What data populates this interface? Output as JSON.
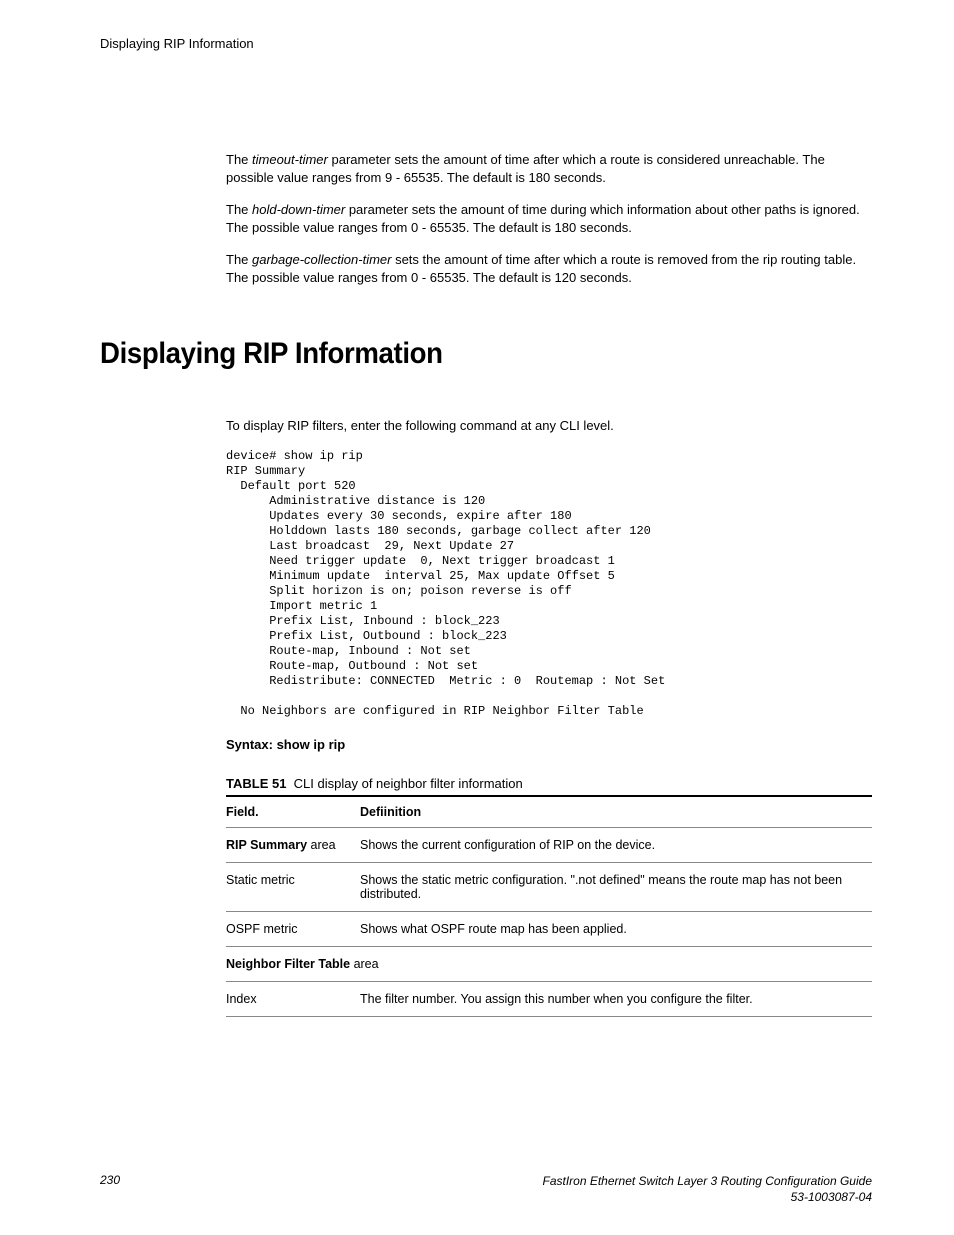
{
  "running_head": "Displaying RIP Information",
  "paragraphs": {
    "p1_pre": "The ",
    "p1_em": "timeout-timer",
    "p1_post": " parameter sets the amount of time after which a route is considered unreachable. The possible value ranges from 9 - 65535. The default is 180 seconds.",
    "p2_pre": "The ",
    "p2_em": "hold-down-timer",
    "p2_post": " parameter sets the amount of time during which information about other paths is ignored. The possible value ranges from 0 - 65535. The default is 180 seconds.",
    "p3_pre": "The ",
    "p3_em": "garbage-collection-timer",
    "p3_post": " sets the amount of time after which a route is removed from the rip routing table. The possible value ranges from 0 - 65535. The default is 120 seconds."
  },
  "section_title": "Displaying RIP Information",
  "intro": "To display RIP filters, enter the following command at any CLI level.",
  "cli_output": "device# show ip rip\nRIP Summary\n  Default port 520\n      Administrative distance is 120\n      Updates every 30 seconds, expire after 180\n      Holddown lasts 180 seconds, garbage collect after 120\n      Last broadcast  29, Next Update 27\n      Need trigger update  0, Next trigger broadcast 1\n      Minimum update  interval 25, Max update Offset 5\n      Split horizon is on; poison reverse is off\n      Import metric 1\n      Prefix List, Inbound : block_223\n      Prefix List, Outbound : block_223\n      Route-map, Inbound : Not set\n      Route-map, Outbound : Not set\n      Redistribute: CONNECTED  Metric : 0  Routemap : Not Set\n\n  No Neighbors are configured in RIP Neighbor Filter Table",
  "syntax_line": "Syntax: show ip rip",
  "table": {
    "number": "TABLE 51",
    "caption": "CLI display of neighbor filter information",
    "head_field": "Field.",
    "head_def": "Defiinition",
    "rows": [
      {
        "field_b": "RIP Summary",
        "field_rest": " area",
        "def": "Shows the current configuration of RIP on the device."
      },
      {
        "field": "Static metric",
        "def": "Shows the static metric configuration. \".not defined\" means the route map has not been distributed."
      },
      {
        "field": "OSPF metric",
        "def": "Shows what OSPF route map has been applied."
      },
      {
        "field_b": "Neighbor Filter Table",
        "field_rest": " area",
        "def": ""
      },
      {
        "field": "Index",
        "def": "The filter number. You assign this number when you configure the filter."
      }
    ]
  },
  "footer": {
    "page": "230",
    "doc_title": "FastIron Ethernet Switch Layer 3 Routing Configuration Guide",
    "doc_num": "53-1003087-04"
  }
}
